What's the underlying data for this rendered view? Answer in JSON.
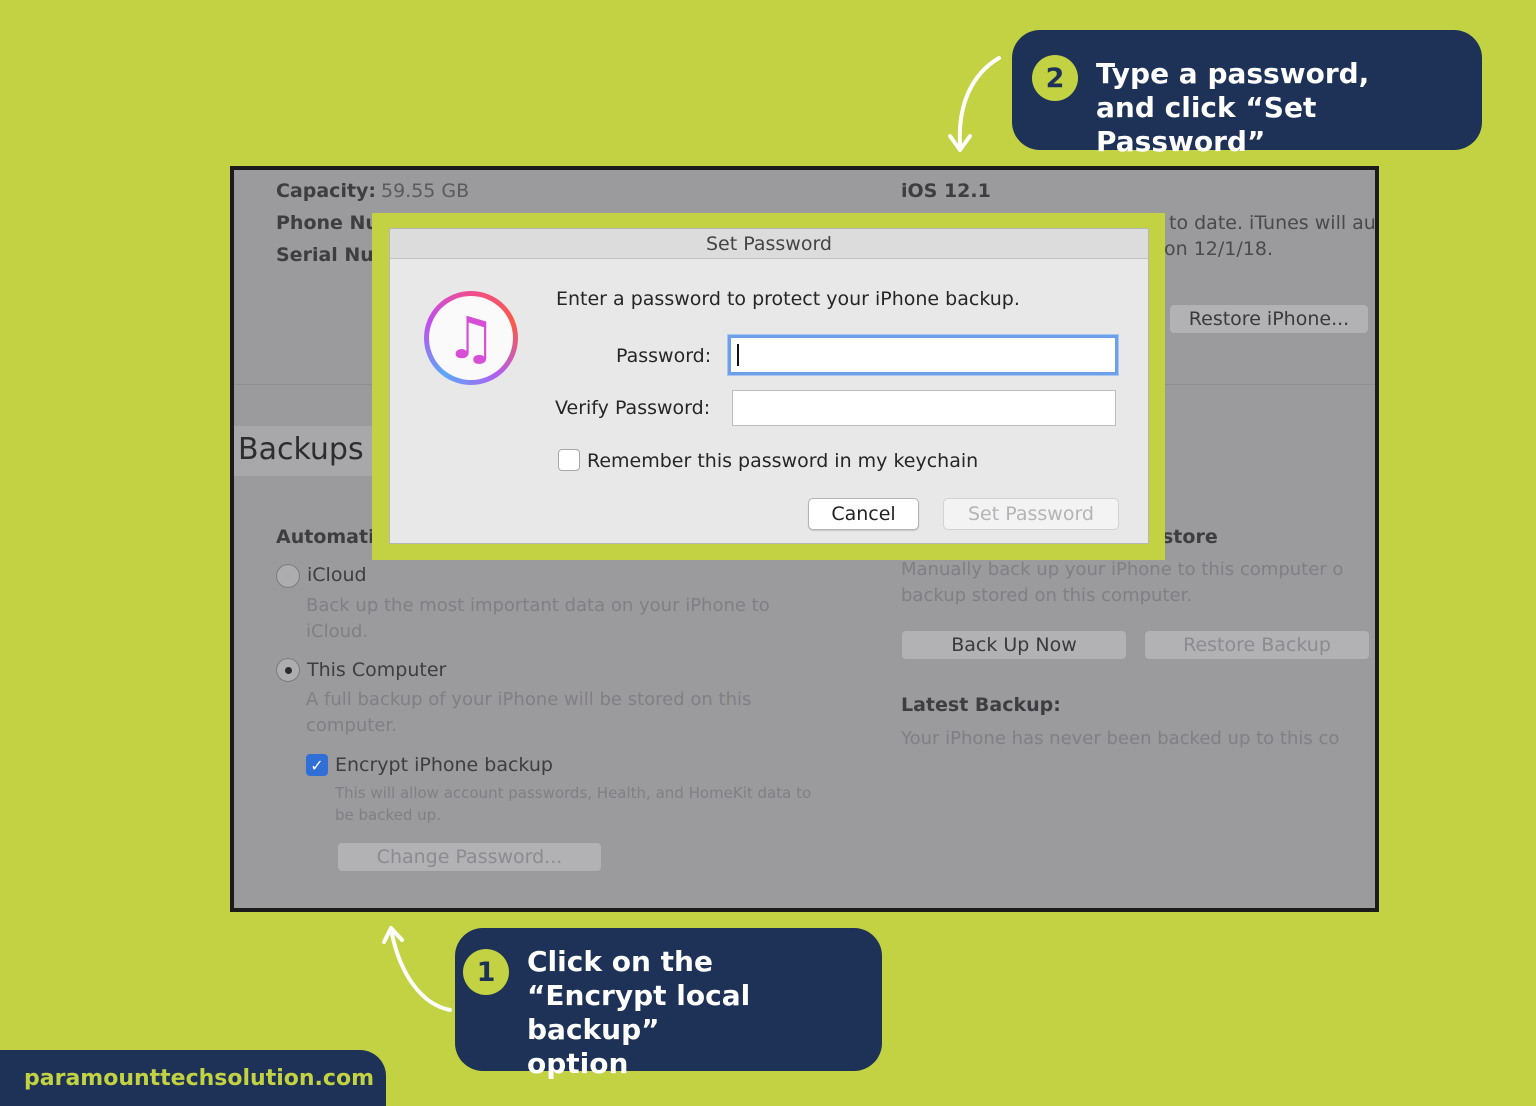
{
  "device_info": {
    "capacity_label": "Capacity:",
    "capacity_value": "59.55 GB",
    "phone_number_label": "Phone Nu",
    "serial_number_label": "Serial Nu",
    "ios_version": "iOS 12.1",
    "update_line_1": "to date. iTunes will au",
    "update_line_2": "on 12/1/18.",
    "restore_button": "Restore iPhone..."
  },
  "backups": {
    "title": "Backups",
    "auto_header": "Automati",
    "icloud_label": "iCloud",
    "icloud_desc_1": "Back up the most important data on your iPhone to",
    "icloud_desc_2": "iCloud.",
    "computer_label": "This Computer",
    "computer_desc_1": "A full backup of your iPhone will be stored on this",
    "computer_desc_2": "computer.",
    "encrypt_label": "Encrypt iPhone backup",
    "encrypt_desc_1": "This will allow account passwords, Health, and HomeKit data to",
    "encrypt_desc_2": "be backed up.",
    "change_password_button": "Change Password...",
    "manual_header": "store",
    "manual_desc_1": "Manually back up your iPhone to this computer o",
    "manual_desc_2": "backup stored on this computer.",
    "back_up_now_button": "Back Up Now",
    "restore_backup_button": "Restore Backup",
    "latest_label": "Latest Backup:",
    "latest_value": "Your iPhone has never been backed up to this co"
  },
  "dialog": {
    "title": "Set Password",
    "prompt": "Enter a password to protect your iPhone backup.",
    "password_label": "Password:",
    "verify_label": "Verify Password:",
    "remember_label": "Remember this password in my keychain",
    "cancel_button": "Cancel",
    "set_button": "Set Password",
    "icon_glyph": "♫"
  },
  "callouts": {
    "step2_number": "2",
    "step2_text": "Type a password,\nand click “Set Password”",
    "step1_number": "1",
    "step1_text": "Click on the\n“Encrypt local backup”\noption"
  },
  "footer": {
    "site": "paramounttechsolution.com"
  },
  "colors": {
    "background": "#c2d243",
    "callout": "#1d3256",
    "focus_ring": "#6ea0ea",
    "checkbox_checked": "#2f6fd6"
  }
}
